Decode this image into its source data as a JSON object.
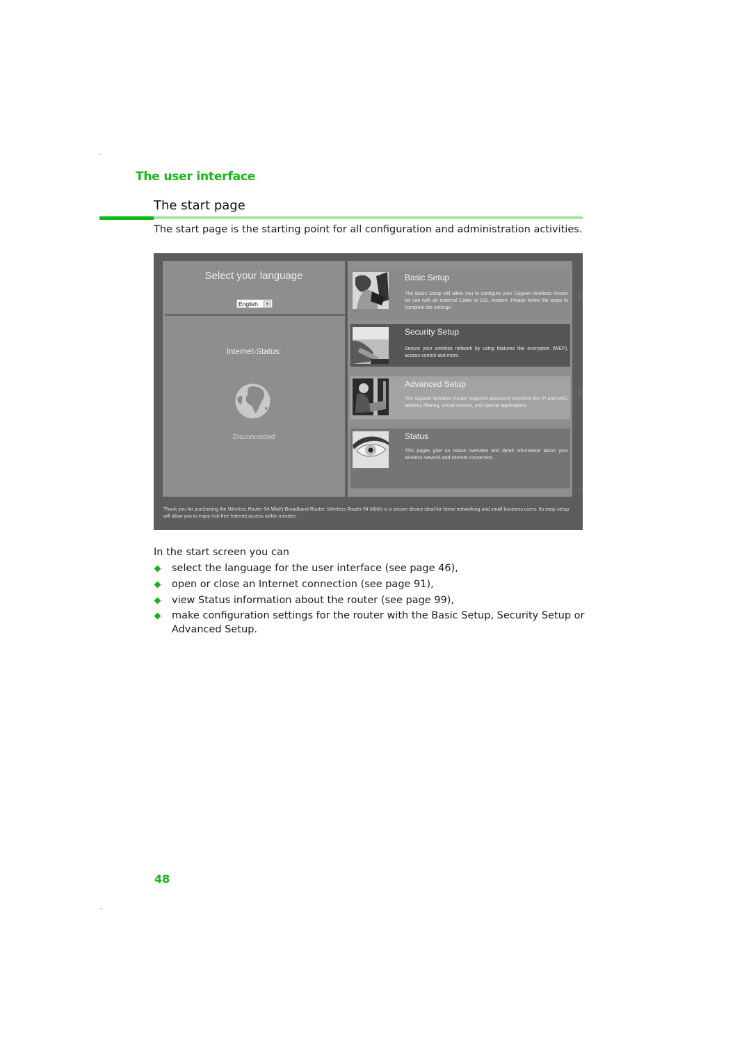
{
  "document": {
    "section_title": "The user interface",
    "page_heading": "The start page",
    "intro": "The start page is the starting point for all configuration and administration activities.",
    "lead": "In the start screen you can",
    "bullets": [
      "select the language for the user interface (see page 46),",
      "open or close an Internet connection (see page 91),",
      "view Status information about the router (see page 99),",
      "make configuration settings for the router with the Basic Setup, Security Setup or Advanced Setup."
    ],
    "page_number": "48",
    "colors": {
      "accent": "#13b813",
      "accent_light": "#a2e6a2"
    }
  },
  "screenshot": {
    "language": {
      "title": "Select your language",
      "selected": "English",
      "dropdown_icon": "chevron-down-icon"
    },
    "internet": {
      "label": "Internet-Status:",
      "icon": "globe-icon",
      "state": "Disconnected"
    },
    "cards": [
      {
        "title": "Basic Setup",
        "icon": "people-photo",
        "desc": "The Basic Setup will allow you to configure your Gigaset Wireless Router for use with an external Cable or DSL modem. Please follow the steps to complete the settings."
      },
      {
        "title": "Security Setup",
        "icon": "hand-photo",
        "desc": "Secure your wireless network by using features like encryption (WEP), access-control and more."
      },
      {
        "title": "Advanced Setup",
        "icon": "person-laptop-photo",
        "desc": "The Gigaset Wireless Router supports advanced functions like IP and MAC address filtering, virtual servers, and special applications."
      },
      {
        "title": "Status",
        "icon": "eye-photo",
        "desc": "This pages give an status overview and detail information about your wireless network and internet connection."
      }
    ],
    "footer": {
      "p1": "Thank you for purchasing the ",
      "product": "Wireless Router 54 Mbit/s",
      "p2": " Broadband Router. ",
      "p3": " is a secure device ideal for home networking and small business users. Its easy setup will allow you to enjoy risk-free Internet access within minutes."
    },
    "edge_glyph": "E"
  }
}
